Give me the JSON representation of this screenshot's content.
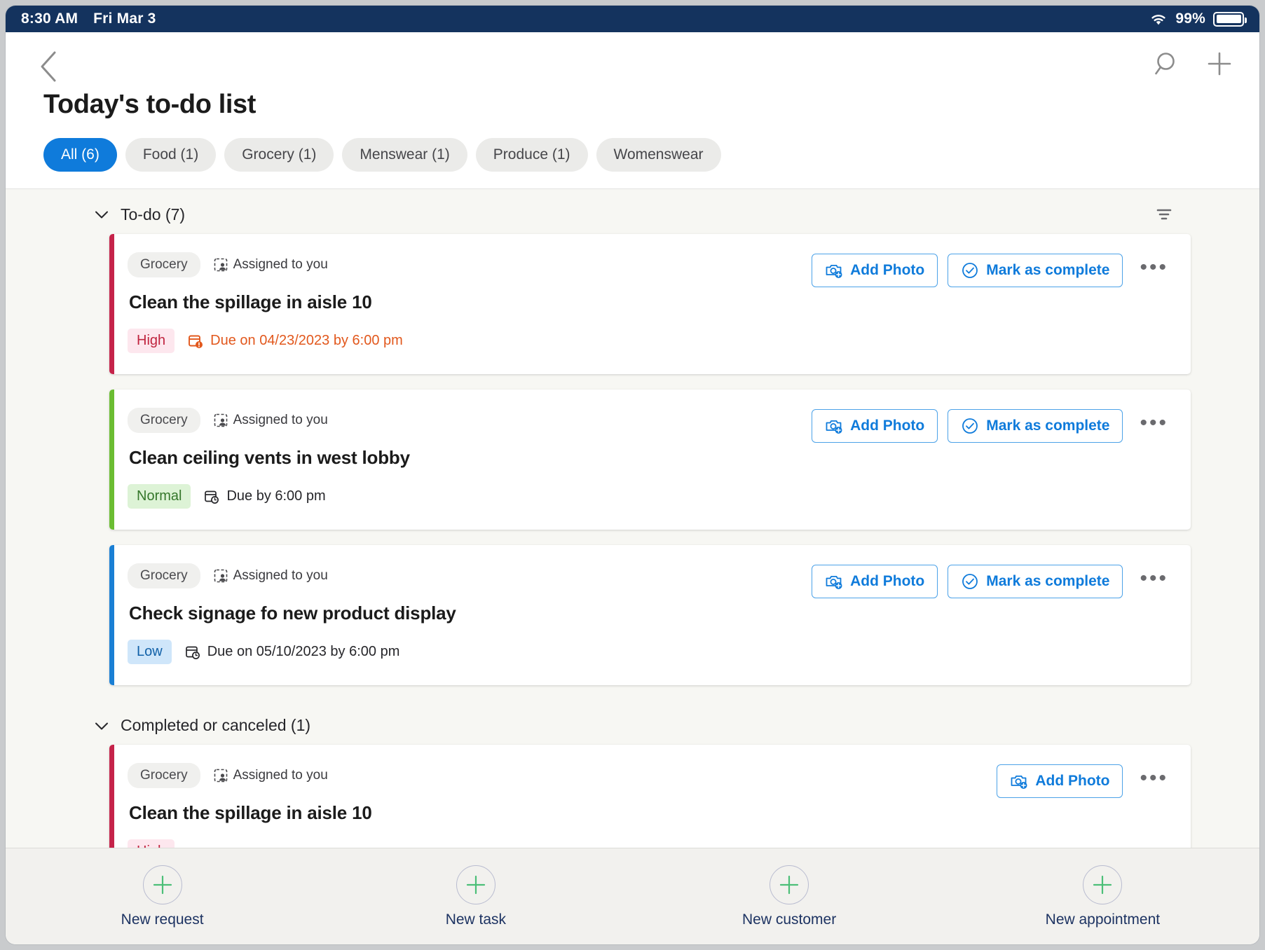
{
  "statusbar": {
    "time": "8:30 AM",
    "date": "Fri Mar 3",
    "battery_percent": "99%",
    "wifi_icon": "wifi-icon",
    "battery_icon": "battery-icon"
  },
  "header": {
    "back_icon": "chevron-left-icon",
    "title": "Today's to-do list",
    "search_icon": "search-icon",
    "add_icon": "plus-icon",
    "filters": [
      {
        "label": "All (6)",
        "active": true
      },
      {
        "label": "Food (1)",
        "active": false
      },
      {
        "label": "Grocery (1)",
        "active": false
      },
      {
        "label": "Menswear (1)",
        "active": false
      },
      {
        "label": "Produce (1)",
        "active": false
      },
      {
        "label": "Womenswear",
        "active": false
      }
    ]
  },
  "sections": [
    {
      "title": "To-do (7)",
      "collapse_icon": "chevron-down-icon",
      "filter_icon": "filter-icon",
      "has_filter": true
    },
    {
      "title": "Completed or canceled (1)",
      "collapse_icon": "chevron-down-icon",
      "has_filter": false
    }
  ],
  "labels": {
    "assigned": "Assigned to you",
    "assigned_icon": "assignment-person-icon",
    "add_photo": "Add Photo",
    "add_photo_icon": "camera-plus-icon",
    "mark_complete": "Mark as complete",
    "mark_complete_icon": "check-circle-icon",
    "more_icon": "ellipsis-icon",
    "due_overdue_icon": "calendar-alert-icon",
    "due_icon": "calendar-clock-icon"
  },
  "todo_tasks": [
    {
      "tag": "Grocery",
      "assigned": "Assigned to you",
      "title": "Clean the spillage in aisle 10",
      "priority": "High",
      "priority_class": "high",
      "due": "Due on 04/23/2023 by 6:00 pm",
      "due_state": "overdue",
      "accent": "#c5234a",
      "add_photo": "Add Photo",
      "mark_complete": "Mark as complete"
    },
    {
      "tag": "Grocery",
      "assigned": "Assigned to you",
      "title": "Clean ceiling vents in west lobby",
      "priority": "Normal",
      "priority_class": "normal",
      "due": "Due by 6:00 pm",
      "due_state": "normal",
      "accent": "#6bbd32",
      "add_photo": "Add Photo",
      "mark_complete": "Mark as complete"
    },
    {
      "tag": "Grocery",
      "assigned": "Assigned to you",
      "title": "Check signage fo new product display",
      "priority": "Low",
      "priority_class": "low",
      "due": "Due on 05/10/2023 by 6:00 pm",
      "due_state": "normal",
      "accent": "#1a7fd4",
      "add_photo": "Add Photo",
      "mark_complete": "Mark as complete"
    }
  ],
  "completed_tasks": [
    {
      "tag": "Grocery",
      "assigned": "Assigned to you",
      "title": "Clean the spillage in aisle 10",
      "priority": "High",
      "priority_class": "high",
      "due": "",
      "accent": "#c5234a",
      "add_photo": "Add Photo"
    }
  ],
  "bottombar": [
    {
      "label": "New request",
      "icon": "plus-circle-icon"
    },
    {
      "label": "New task",
      "icon": "plus-circle-icon"
    },
    {
      "label": "New customer",
      "icon": "plus-circle-icon"
    },
    {
      "label": "New appointment",
      "icon": "plus-circle-icon"
    }
  ],
  "colors": {
    "statusbar_bg": "#14335e",
    "accent_blue": "#0f7bdb",
    "high": "#c0243f",
    "normal": "#35772b",
    "low": "#1161a8",
    "overdue_text": "#e2581d",
    "plus_green": "#4cbf78"
  }
}
